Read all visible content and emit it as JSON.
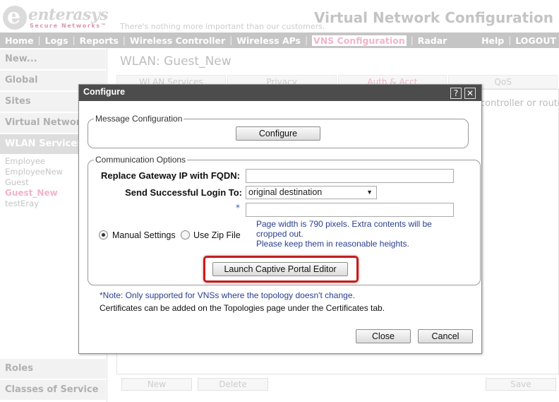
{
  "header": {
    "brand": "enterasys",
    "brand_sub": "Secure Networks™",
    "tagline": "There's nothing more important than our customers.",
    "page_heading": "Virtual Network Configuration"
  },
  "nav": {
    "left": [
      "Home",
      "Logs",
      "Reports",
      "Wireless Controller",
      "Wireless APs",
      "VNS Configuration",
      "Radar"
    ],
    "active": "VNS Configuration",
    "right": [
      "Help",
      "LOGOUT"
    ]
  },
  "sidebar": {
    "sections_top": [
      "New...",
      "Global",
      "Sites",
      "Virtual Networks"
    ],
    "active_section": "WLAN Services",
    "items": [
      "Employee",
      "EmployeeNew",
      "Guest",
      "Guest_New",
      "testEray"
    ],
    "active_item": "Guest_New",
    "sections_bottom": [
      "Roles",
      "Classes of Service"
    ]
  },
  "main": {
    "title": "WLAN: Guest_New",
    "tabs": [
      "WLAN Services",
      "Privacy",
      "Auth & Acct",
      "QoS"
    ],
    "active_tab": "Auth & Acct",
    "background_text": "controller or routed",
    "buttons": {
      "new": "New",
      "delete": "Delete",
      "save": "Save"
    }
  },
  "dialog": {
    "title": "Configure",
    "help_glyph": "?",
    "close_glyph": "✕",
    "message_config": {
      "legend": "Message Configuration",
      "button": "Configure"
    },
    "comm_options": {
      "legend": "Communication Options",
      "fqdn_label": "Replace Gateway IP with FQDN:",
      "fqdn_value": "",
      "login_label": "Send Successful Login To:",
      "login_value": "original destination",
      "required_star": "*",
      "url_value": "",
      "page_note_1": "Page width is 790 pixels. Extra contents will be cropped out.",
      "page_note_2": "Please keep them in reasonable heights.",
      "radio_manual": "Manual Settings",
      "radio_zip": "Use Zip File",
      "launch_button": "Launch Captive Portal Editor"
    },
    "note_vns": "*Note: Only supported for VNSs where the topology doesn't change.",
    "note_certs": "Certificates can be added on the Topologies page under the Certificates tab.",
    "close_button": "Close",
    "cancel_button": "Cancel"
  },
  "colors": {
    "accent_pink": "#e87fa0",
    "nav_gray": "#9b9b9b",
    "dialog_titlebar": "#4c4c4c",
    "highlight_red": "#c41e1e",
    "note_blue": "#2a3f8f"
  }
}
